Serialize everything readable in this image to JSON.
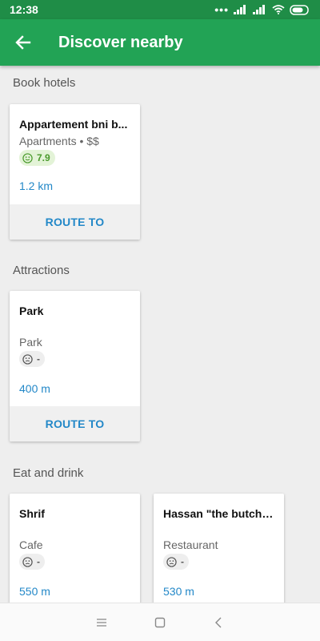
{
  "status_bar": {
    "time": "12:38"
  },
  "app_bar": {
    "title": "Discover nearby",
    "back_icon": "arrow-left-icon"
  },
  "sections": {
    "hotels": {
      "title": "Book hotels",
      "cards": [
        {
          "title": "Appartement bni b...",
          "subtitle": "Apartments • $$",
          "rating": "7.9",
          "distance": "1.2 km",
          "route_label": "ROUTE TO"
        }
      ]
    },
    "attractions": {
      "title": "Attractions",
      "cards": [
        {
          "title": "Park",
          "subtitle": "Park",
          "rating": "-",
          "distance": "400 m",
          "route_label": "ROUTE TO"
        }
      ]
    },
    "eat": {
      "title": "Eat and drink",
      "cards": [
        {
          "title": "Shrif",
          "subtitle": "Cafe",
          "rating": "-",
          "distance": "550 m"
        },
        {
          "title": "Hassan \"the butcher\"",
          "subtitle": "Restaurant",
          "rating": "-",
          "distance": "530 m"
        }
      ]
    }
  },
  "colors": {
    "status_bar": "#1f8d47",
    "app_bar": "#22a355",
    "link": "#2388c8",
    "rating_good": "#4a9a2c"
  }
}
